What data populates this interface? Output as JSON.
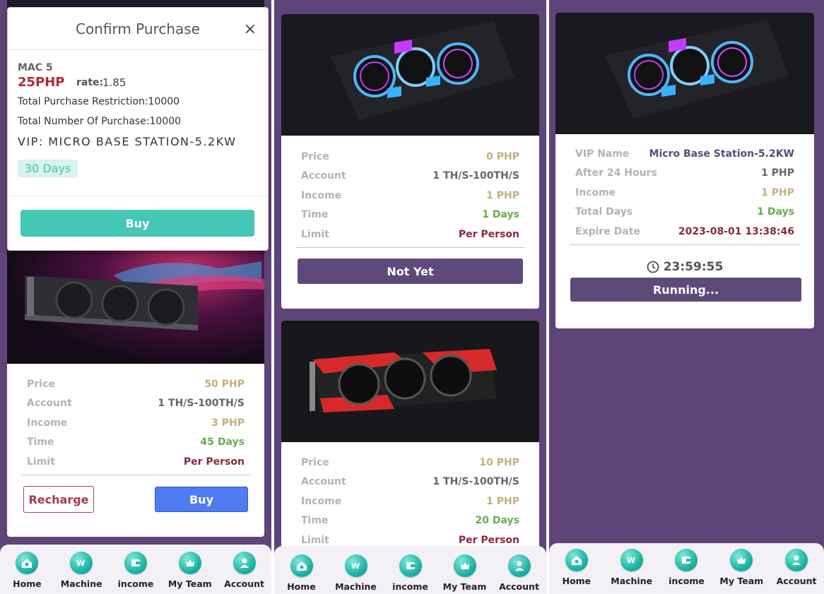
{
  "nav": {
    "items": [
      {
        "label": "Home",
        "icon": "home-icon"
      },
      {
        "label": "Machine",
        "icon": "machine-icon"
      },
      {
        "label": "income",
        "icon": "wallet-icon"
      },
      {
        "label": "My Team",
        "icon": "crown-icon"
      },
      {
        "label": "Account",
        "icon": "user-icon"
      }
    ]
  },
  "colors": {
    "background": "#5e4478",
    "accent_teal": "#45c7b6",
    "button_purple": "#5e4a7a",
    "button_blue": "#4f7cf2",
    "price_tan": "#c4b07a",
    "days_green": "#69ab54",
    "limit_red": "#8a2a3a"
  },
  "panel1": {
    "modal": {
      "title": "Confirm Purchase",
      "close": "×",
      "product": "MAC 5",
      "price": "25PHP",
      "rate_label": "rate:",
      "rate_value": "1.85",
      "restriction": "Total Purchase Restriction:10000",
      "number_of_purchase": "Total Number Of Purchase:10000",
      "vip": "VIP: MICRO BASE STATION-5.2KW",
      "days_badge": "30 Days",
      "buy": "Buy"
    },
    "card": {
      "rows": [
        {
          "label": "Price",
          "value": "50 PHP",
          "style": "tan"
        },
        {
          "label": "Account",
          "value": "1 TH/S-100TH/S",
          "style": "gray"
        },
        {
          "label": "Income",
          "value": "3 PHP",
          "style": "tan"
        },
        {
          "label": "Time",
          "value": "45 Days",
          "style": "green"
        },
        {
          "label": "Limit",
          "value": "Per Person",
          "style": "red"
        }
      ],
      "recharge": "Recharge",
      "buy": "Buy"
    }
  },
  "panel2": {
    "card1": {
      "rows": [
        {
          "label": "Price",
          "value": "0 PHP"
        },
        {
          "label": "Account",
          "value": "1 TH/S-100TH/S"
        },
        {
          "label": "Income",
          "value": "1 PHP"
        },
        {
          "label": "Time",
          "value": "1 Days"
        },
        {
          "label": "Limit",
          "value": "Per Person"
        }
      ],
      "button": "Not Yet"
    },
    "card2": {
      "rows": [
        {
          "label": "Price",
          "value": "10 PHP"
        },
        {
          "label": "Account",
          "value": "1 TH/S-100TH/S"
        },
        {
          "label": "Income",
          "value": "1 PHP"
        },
        {
          "label": "Time",
          "value": "20 Days"
        },
        {
          "label": "Limit",
          "value": "Per Person"
        }
      ]
    }
  },
  "panel3": {
    "card": {
      "rows": [
        {
          "label": "VIP Name",
          "value": "Micro Base Station-5.2KW"
        },
        {
          "label": "After 24 Hours",
          "value": "1 PHP"
        },
        {
          "label": "Income",
          "value": "1 PHP"
        },
        {
          "label": "Total Days",
          "value": "1 Days"
        },
        {
          "label": "Expire Date",
          "value": "2023-08-01 13:38:46"
        }
      ],
      "timer": "23:59:55",
      "button": "Running..."
    }
  }
}
